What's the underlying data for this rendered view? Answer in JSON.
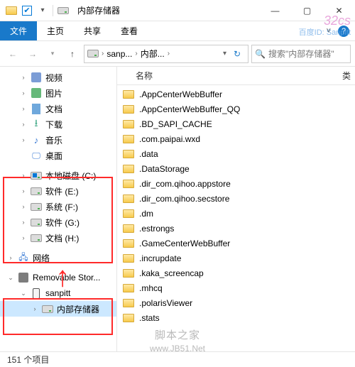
{
  "window": {
    "title": "内部存储器"
  },
  "ribbon": {
    "file": "文件",
    "tabs": [
      "主页",
      "共享",
      "查看"
    ]
  },
  "breadcrumb": {
    "segments": [
      "sanp...",
      "内部..."
    ],
    "search_placeholder": "搜索\"内部存储器\""
  },
  "tree": {
    "items": [
      {
        "icon": "video",
        "label": "视频",
        "level": 1,
        "exp": ">"
      },
      {
        "icon": "pic",
        "label": "图片",
        "level": 1,
        "exp": ">"
      },
      {
        "icon": "doc",
        "label": "文档",
        "level": 1,
        "exp": ">"
      },
      {
        "icon": "dl",
        "label": "下载",
        "level": 1,
        "exp": ">"
      },
      {
        "icon": "music",
        "label": "音乐",
        "level": 1,
        "exp": ">"
      },
      {
        "icon": "desk",
        "label": "桌面",
        "level": 1,
        "exp": ""
      },
      {
        "icon": "drive-win",
        "label": "本地磁盘 (C:)",
        "level": 1,
        "exp": ">"
      },
      {
        "icon": "drive",
        "label": "软件 (E:)",
        "level": 1,
        "exp": ">"
      },
      {
        "icon": "drive",
        "label": "系统 (F:)",
        "level": 1,
        "exp": ">"
      },
      {
        "icon": "drive",
        "label": "软件 (G:)",
        "level": 1,
        "exp": ">"
      },
      {
        "icon": "drive",
        "label": "文档 (H:)",
        "level": 1,
        "exp": ">"
      },
      {
        "icon": "net",
        "label": "网络",
        "level": 0,
        "exp": ">"
      },
      {
        "icon": "removable",
        "label": "Removable Stor...",
        "level": 0,
        "exp": "v"
      },
      {
        "icon": "phone",
        "label": "sanpitt",
        "level": 1,
        "exp": "v"
      },
      {
        "icon": "drive",
        "label": "内部存储器",
        "level": 2,
        "exp": ">",
        "selected": true
      }
    ]
  },
  "content": {
    "header_name": "名称",
    "header_right": "类",
    "files": [
      ".AppCenterWebBuffer",
      ".AppCenterWebBuffer_QQ",
      ".BD_SAPI_CACHE",
      ".com.paipai.wxd",
      ".data",
      ".DataStorage",
      ".dir_com.qihoo.appstore",
      ".dir_com.qihoo.secstore",
      ".dm",
      ".estrongs",
      ".GameCenterWebBuffer",
      ".incrupdate",
      ".kaka_screencap",
      ".mhcq",
      ".polarisViewer",
      ".stats"
    ]
  },
  "status": {
    "count_label": "151 个项目"
  },
  "watermark": {
    "line1": "百度ID: Sanpitt",
    "footer1": "脚本之家",
    "footer2": "www.JB51.Net"
  }
}
